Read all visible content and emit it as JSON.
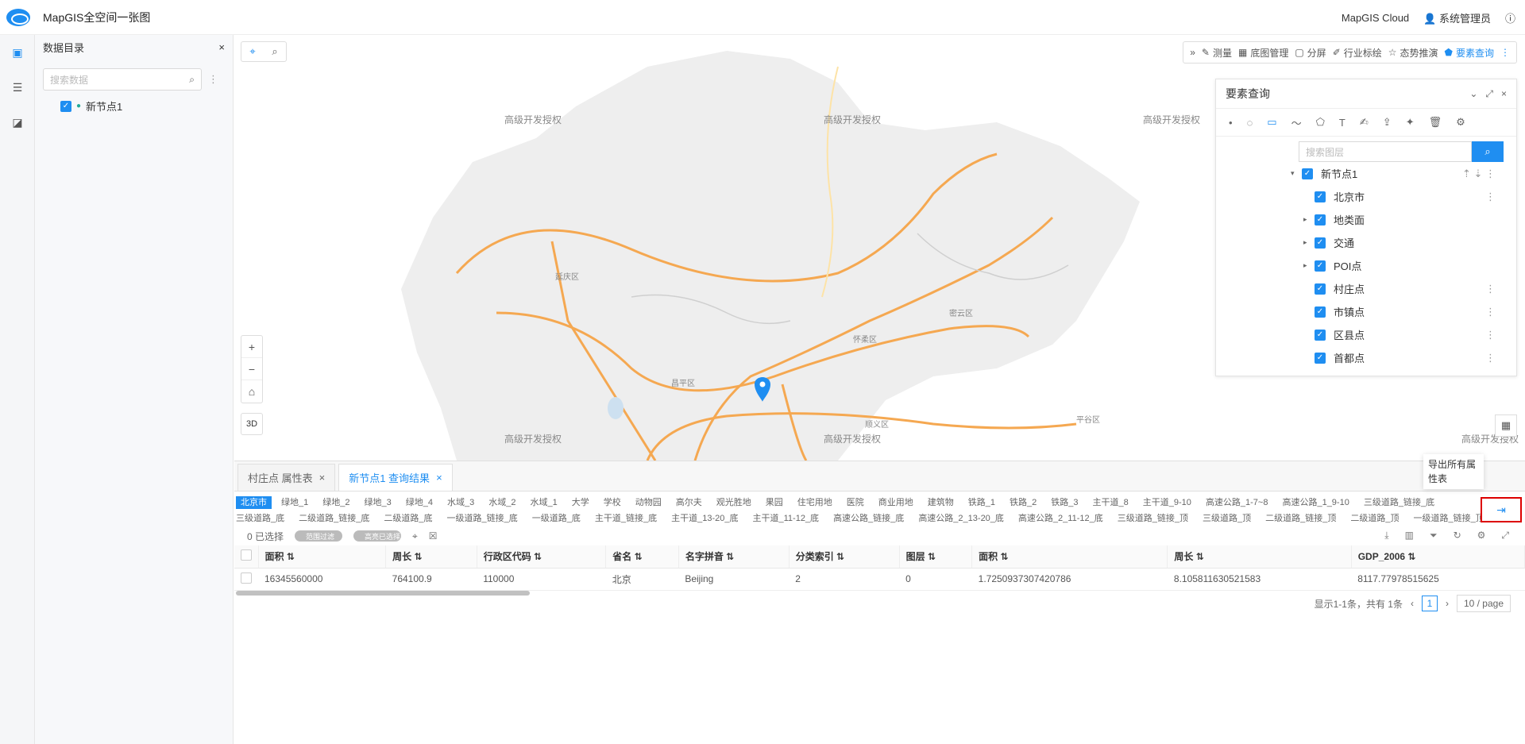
{
  "app": {
    "title": "MapGIS全空间一张图",
    "cloud": "MapGIS Cloud",
    "user": "系统管理员"
  },
  "catalog": {
    "title": "数据目录",
    "search_placeholder": "搜索数据",
    "node": "新节点1"
  },
  "map": {
    "watermark": "高级开发授权",
    "districts": [
      "延庆区",
      "怀柔区",
      "密云区",
      "昌平区",
      "顺义区",
      "平谷区"
    ],
    "zoom_in": "+",
    "zoom_out": "−",
    "home": "⌂",
    "btn3d": "3D"
  },
  "toolbar": {
    "items": [
      "测量",
      "底图管理",
      "分屏",
      "行业标绘",
      "态势推演",
      "要素查询"
    ]
  },
  "feature_query": {
    "title": "要素查询",
    "search_placeholder": "搜索图层",
    "tree": [
      {
        "label": "新节点1",
        "expand": "▾",
        "level": 0
      },
      {
        "label": "北京市",
        "expand": "",
        "level": 1
      },
      {
        "label": "地类面",
        "expand": "▸",
        "level": 1
      },
      {
        "label": "交通",
        "expand": "▸",
        "level": 1
      },
      {
        "label": "POI点",
        "expand": "▸",
        "level": 1
      },
      {
        "label": "村庄点",
        "expand": "",
        "level": 1
      },
      {
        "label": "市镇点",
        "expand": "",
        "level": 1
      },
      {
        "label": "区县点",
        "expand": "",
        "level": 1
      },
      {
        "label": "首都点",
        "expand": "",
        "level": 1
      }
    ]
  },
  "bottom": {
    "tabs": [
      "村庄点 属性表",
      "新节点1 查询结果"
    ],
    "layer_tags_row1": [
      "北京市",
      "绿地_1",
      "绿地_2",
      "绿地_3",
      "绿地_4",
      "水域_3",
      "水域_2",
      "水域_1",
      "大学",
      "学校",
      "动物园",
      "高尔夫",
      "观光胜地",
      "果园",
      "住宅用地",
      "医院",
      "商业用地",
      "建筑物",
      "铁路_1",
      "铁路_2",
      "铁路_3",
      "主干道_8",
      "主干道_9-10",
      "高速公路_1-7~8",
      "高速公路_1_9-10",
      "三级道路_链接_底"
    ],
    "layer_tags_row2": [
      "三级道路_底",
      "二级道路_链接_底",
      "二级道路_底",
      "一级道路_链接_底",
      "一级道路_底",
      "主干道_链接_底",
      "主干道_13-20_底",
      "主干道_11-12_底",
      "高速公路_链接_底",
      "高速公路_2_13-20_底",
      "高速公路_2_11-12_底",
      "三级道路_链接_顶",
      "三级道路_顶",
      "二级道路_链接_顶",
      "二级道路_顶",
      "一级道路_链接_顶"
    ],
    "selected": "0 已选择",
    "toggle1": "范围过滤",
    "toggle2": "高亮已选择",
    "columns": [
      "面积",
      "周长",
      "行政区代码",
      "省名",
      "名字拼音",
      "分类索引",
      "图层",
      "面积",
      "周长",
      "GDP_2006"
    ],
    "rows": [
      [
        "16345560000",
        "764100.9",
        "110000",
        "北京",
        "Beijing",
        "2",
        "0",
        "1.7250937307420786",
        "8.105811630521583",
        "8117.77978515625"
      ]
    ],
    "pager": {
      "summary": "显示1-1条，共有 1条",
      "page": "1",
      "size": "10 / page"
    },
    "export_tooltip": "导出所有属性表"
  }
}
